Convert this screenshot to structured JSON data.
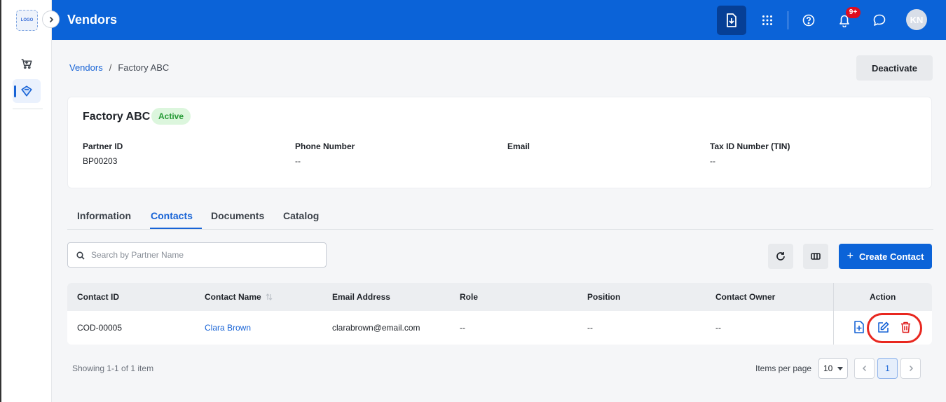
{
  "app": {
    "title": "Vendors",
    "logo_text": "LOGO",
    "notification_count": "9+",
    "user_initials": "KN"
  },
  "sidebar": {
    "items": [
      {
        "icon": "cart-icon",
        "label": "Cart"
      },
      {
        "icon": "vendor-tag-icon",
        "label": "Vendors",
        "active": true
      }
    ]
  },
  "breadcrumb": {
    "parent": "Vendors",
    "separator": "/",
    "current": "Factory ABC"
  },
  "header_actions": {
    "deactivate_label": "Deactivate"
  },
  "vendor": {
    "name": "Factory ABC",
    "status": "Active",
    "fields": [
      {
        "label": "Partner ID",
        "value": "BP00203"
      },
      {
        "label": "Phone Number",
        "value": "--"
      },
      {
        "label": "Email",
        "value": ""
      },
      {
        "label": "Tax ID Number (TIN)",
        "value": "--"
      }
    ]
  },
  "tabs": [
    {
      "label": "Information",
      "active": false
    },
    {
      "label": "Contacts",
      "active": true
    },
    {
      "label": "Documents",
      "active": false
    },
    {
      "label": "Catalog",
      "active": false
    }
  ],
  "toolbar": {
    "search_placeholder": "Search by Partner Name",
    "create_label": "Create Contact"
  },
  "table": {
    "columns": [
      "Contact ID",
      "Contact Name",
      "Email Address",
      "Role",
      "Position",
      "Contact Owner",
      "Action"
    ],
    "rows": [
      {
        "contact_id": "COD-00005",
        "contact_name": "Clara Brown",
        "email": "clarabrown@email.com",
        "role": "--",
        "position": "--",
        "owner": "--"
      }
    ]
  },
  "pagination": {
    "summary": "Showing 1-1 of 1 item",
    "items_per_page_label": "Items per page",
    "items_per_page": "10",
    "current_page": "1"
  },
  "colors": {
    "primary": "#0b63d8",
    "active_status_bg": "#dcf6dd",
    "delete": "#e02424",
    "highlight": "#e8271f"
  }
}
